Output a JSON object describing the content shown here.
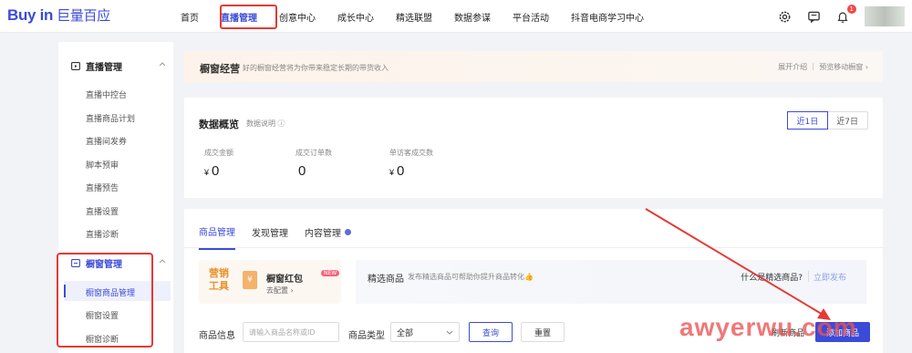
{
  "logo": {
    "brand": "Buy in",
    "cn": "巨量百应"
  },
  "nav": {
    "items": [
      "首页",
      "直播管理",
      "创意中心",
      "成长中心",
      "精选联盟",
      "数据参谋",
      "平台活动",
      "抖音电商学习中心"
    ],
    "notification_count": "1"
  },
  "sidebar": {
    "live_group": "直播管理",
    "live_items": [
      "直播中控台",
      "直播商品计划",
      "直播间发券",
      "脚本预审",
      "直播预告",
      "直播设置",
      "直播诊断"
    ],
    "window_group": "橱窗管理",
    "window_items": [
      "橱窗商品管理",
      "橱窗设置",
      "橱窗诊断"
    ]
  },
  "promo": {
    "title": "橱窗经营",
    "subtitle": "好的橱窗经营将为你带来稳定长期的带货收入",
    "links": "展开介绍 ｜ 预览移动橱窗 ›"
  },
  "overview": {
    "title": "数据概览",
    "hint": "数据说明 ⓘ",
    "ranges": [
      "近1日",
      "近7日"
    ],
    "metrics": [
      {
        "label": "成交金额",
        "currency": "¥",
        "value": "0"
      },
      {
        "label": "成交订单数",
        "currency": "",
        "value": "0"
      },
      {
        "label": "单访客成交数",
        "currency": "¥",
        "value": "0"
      }
    ]
  },
  "goods": {
    "tabs": [
      "商品管理",
      "发现管理",
      "内容管理"
    ],
    "tool": {
      "tag": "营销工具",
      "name": "橱窗红包",
      "badge": "NEW",
      "link": "去配置 ›"
    },
    "pick": {
      "title": "精选商品",
      "desc": "发布精选商品可帮助你提升商品转化👍",
      "question": "什么是精选商品?",
      "publish": "立即发布"
    },
    "filters": {
      "info_label": "商品信息",
      "info_placeholder": "请输入商品名称或ID",
      "type_label": "商品类型",
      "type_value": "全部",
      "query": "查询",
      "reset": "重置",
      "refresh": "刷新商品",
      "add": "添加商品"
    }
  },
  "watermark": "awyerwu.com",
  "colors": {
    "accent": "#3b4bd8",
    "highlight": "#e53935"
  }
}
